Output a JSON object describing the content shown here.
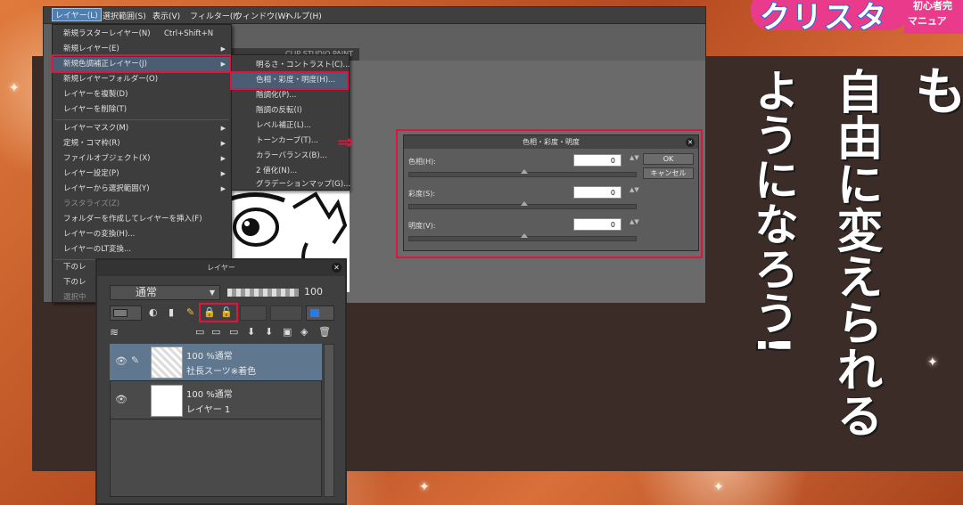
{
  "menubar": [
    "レイヤー(L)",
    "選択範囲(S)",
    "表示(V)",
    "フィルター(I)",
    "ウィンドウ(W)",
    "ヘルプ(H)"
  ],
  "doc_tab": "CLIP STUDIO PAINT",
  "layer_menu": [
    {
      "label": "新規ラスターレイヤー(N)",
      "shortcut": "Ctrl+Shift+N"
    },
    {
      "label": "新規レイヤー(E)",
      "arrow": "▶"
    },
    {
      "label": "新規色調補正レイヤー(J)",
      "arrow": "▶"
    },
    {
      "label": "新規レイヤーフォルダー(O)"
    },
    {
      "label": "レイヤーを複製(D)"
    },
    {
      "label": "レイヤーを削除(T)"
    },
    {
      "label": "レイヤーマスク(M)",
      "arrow": "▶"
    },
    {
      "label": "定規・コマ枠(R)",
      "arrow": "▶"
    },
    {
      "label": "ファイルオブジェクト(X)",
      "arrow": "▶"
    },
    {
      "label": "レイヤー設定(P)",
      "arrow": "▶"
    },
    {
      "label": "レイヤーから選択範囲(Y)",
      "arrow": "▶"
    },
    {
      "label": "ラスタライズ(Z)"
    },
    {
      "label": "フォルダーを作成してレイヤーを挿入(F)"
    },
    {
      "label": "レイヤーの変換(H)..."
    },
    {
      "label": "レイヤーのLT変換..."
    },
    {
      "label": "下のレ"
    },
    {
      "label": "下のレ"
    },
    {
      "label": "選択中"
    }
  ],
  "submenu": [
    "明るさ・コントラスト(C)...",
    "色相・彩度・明度(H)...",
    "階調化(P)...",
    "階調の反転(I)",
    "レベル補正(L)...",
    "トーンカーブ(T)...",
    "カラーバランス(B)...",
    "2 値化(N)...",
    "グラデーションマップ(G)..."
  ],
  "arrow_glyph": "⇒",
  "dialog": {
    "title": "色相・彩度・明度",
    "close": "✕",
    "hue_label": "色相(H):",
    "hue_value": "0",
    "sat_label": "彩度(S):",
    "sat_value": "0",
    "lum_label": "明度(V):",
    "lum_value": "0",
    "ok": "OK",
    "cancel": "キャンセル",
    "spin": "▲▼"
  },
  "layer_panel": {
    "title": "レイヤー",
    "close": "✕",
    "blend_mode": "通常",
    "opacity": "100",
    "layers": [
      {
        "line1": "100 %通常",
        "line2": "社長スーツ※着色"
      },
      {
        "line1": "100 %通常",
        "line2": "レイヤー 1"
      }
    ]
  },
  "headline": {
    "col1": "線の色をいつでも",
    "col2": "自由に変えられる",
    "col3": "ようになろう!"
  },
  "logo": {
    "text": "クリスタ",
    "sub1": "初心者完",
    "sub2": "マニュア"
  },
  "colors": {
    "highlight": "#e0143c",
    "selected_layer": "#5f7890"
  }
}
